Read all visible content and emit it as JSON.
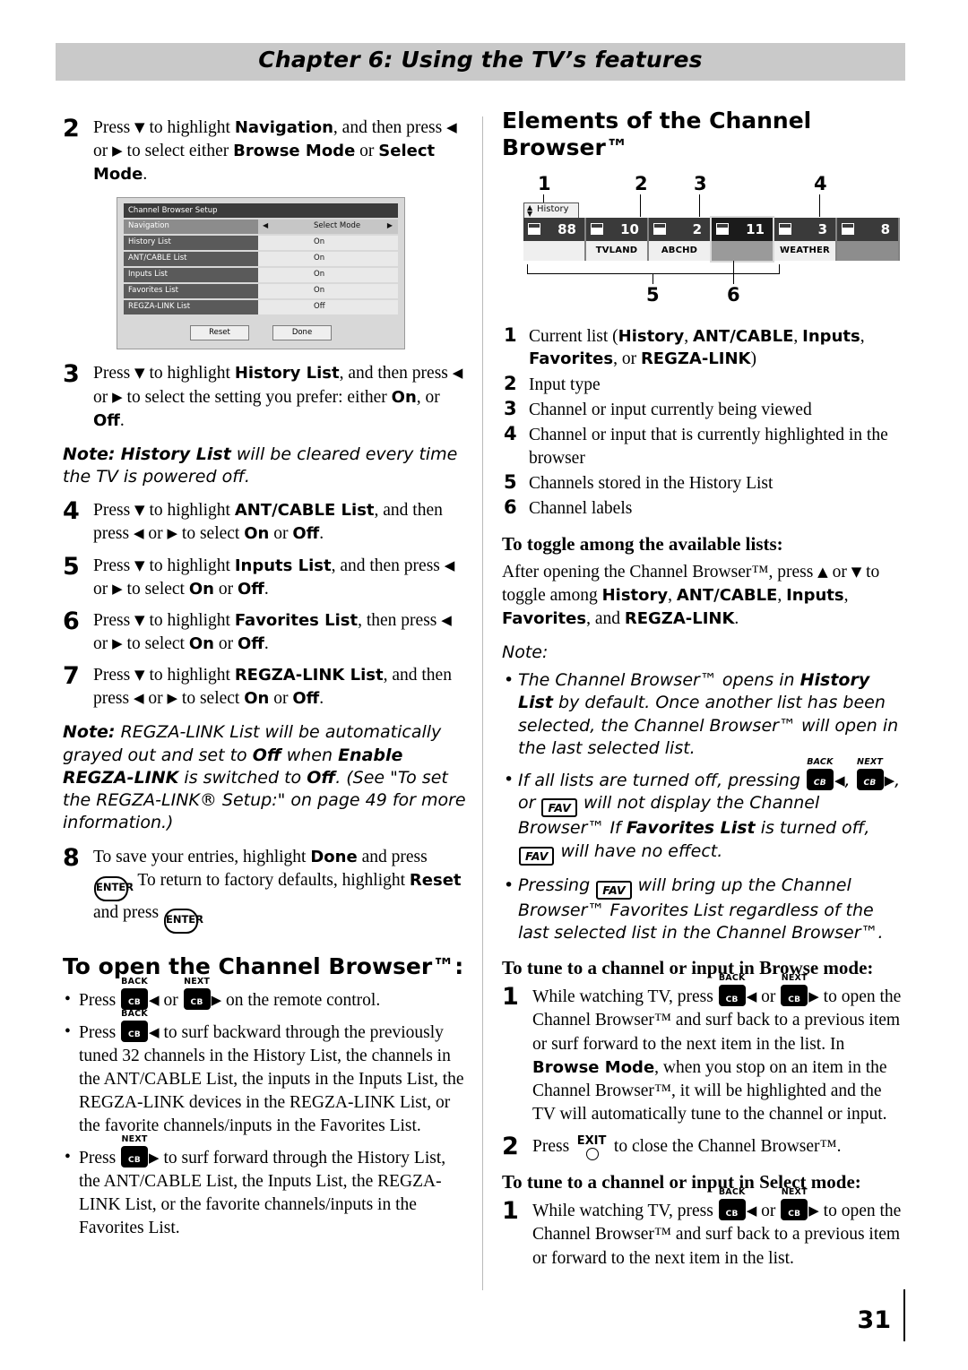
{
  "header": {
    "chapter_title": "Chapter 6: Using the TV’s features"
  },
  "footer": {
    "page_number": "31"
  },
  "left": {
    "step2": {
      "num": "2",
      "text_1": "Press ",
      "arrow_down": "▼",
      "text_2": " to highlight ",
      "b_navigation": "Navigation",
      "text_3": ", and then press ",
      "arrow_left": "◀",
      "text_4": " or ",
      "arrow_right": "▶",
      "text_5": " to select either ",
      "b_browse_mode": "Browse Mode",
      "text_6": " or ",
      "b_select_mode": "Select",
      "b_select_mode2": "Mode",
      "text_7": "."
    },
    "menu": {
      "title": "Channel Browser Setup",
      "rows": [
        {
          "label": "Navigation",
          "value": "Select Mode",
          "highlight": true
        },
        {
          "label": "History List",
          "value": "On",
          "highlight": false
        },
        {
          "label": "ANT/CABLE List",
          "value": "On",
          "highlight": false
        },
        {
          "label": "Inputs List",
          "value": "On",
          "highlight": false
        },
        {
          "label": "Favorites List",
          "value": "On",
          "highlight": false
        },
        {
          "label": "REGZA-LINK List",
          "value": "Off",
          "highlight": false
        }
      ],
      "buttons": {
        "reset": "Reset",
        "done": "Done"
      }
    },
    "step3": {
      "num": "3",
      "p1": "Press ",
      "p2": " to highlight ",
      "b1": "History List",
      "p3": ", and then press ",
      "p4": " or ",
      "p5": " to select the setting you prefer: either ",
      "b2": "On",
      "p6": ", or ",
      "b3": "Off",
      "p7": "."
    },
    "note1": {
      "lead": "Note:",
      "b1": "History List",
      "rest": " will be cleared every time the TV is powered off."
    },
    "step4": {
      "num": "4",
      "p1": "Press ",
      "p2": " to highlight ",
      "b1": "ANT/CABLE List",
      "p3": ", and then press ",
      "p4": " or ",
      "p5": " to select ",
      "b2": "On",
      "p6": " or ",
      "b3": "Off",
      "p7": "."
    },
    "step5": {
      "num": "5",
      "p1": "Press ",
      "p2": " to highlight ",
      "b1": "Inputs List",
      "p3": ", and then press ",
      "p4": " or ",
      "p5": " to select ",
      "b2": "On",
      "p6": " or ",
      "b3": "Off",
      "p7": "."
    },
    "step6": {
      "num": "6",
      "p1": "Press ",
      "p2": " to highlight ",
      "b1": "Favorites List",
      "p3": ", then press ",
      "p4": " or ",
      "p5": " to select ",
      "b2": "On",
      "p6": " or ",
      "b3": "Off",
      "p7": "."
    },
    "step7": {
      "num": "7",
      "p1": "Press ",
      "p2": " to highlight ",
      "b1": "REGZA-LINK List",
      "p3": ", and then press ",
      "p4": " or ",
      "p5": " to select ",
      "b2": "On",
      "p6": " or ",
      "b3": "Off",
      "p7": "."
    },
    "note2": {
      "lead": "Note:",
      "t1": " REGZA-LINK List will be automatically grayed out and set to ",
      "b1": "Off",
      "t2": " when ",
      "b2": "Enable REGZA-LINK",
      "t3": " is switched to ",
      "b3": "Off",
      "t4": ". (See \"To set the REGZA-LINK® Setup:\" on page 49 for more information.)"
    },
    "step8": {
      "num": "8",
      "p1": "To save your entries, highlight ",
      "b1": "Done",
      "p2": " and press ",
      "key1": "ENTER",
      "p3": ". To return to factory defaults, highlight ",
      "b2": "Reset",
      "p4": " and press ",
      "key2": "ENTER",
      "p5": "."
    },
    "heading_open": "To open the Channel Browser™:",
    "bullets": [
      {
        "p1": "Press ",
        "k1_top": "BACK",
        "k1_lbl": "CB",
        "a1": "◀",
        "p2": " or ",
        "k2_top": "NEXT",
        "k2_lbl": "CB",
        "a2": "▶",
        "p3": " on the remote control."
      },
      {
        "p1": "Press ",
        "k1_top": "BACK",
        "k1_lbl": "CB",
        "a1": "◀",
        "p2": " to surf backward through the previously tuned 32 channels in the History List, the channels in the ANT/CABLE List, the inputs in the Inputs List, the REGZA-LINK devices in the REGZA-LINK List, or the favorite channels/inputs in the Favorites List."
      },
      {
        "p1": "Press ",
        "k1_top": "NEXT",
        "k1_lbl": "CB",
        "a1": "▶",
        "p2": " to surf forward through the History List, the ANT/CABLE List, the Inputs List, the REGZA-LINK List, or the favorite channels/inputs in the Favorites List."
      }
    ]
  },
  "right": {
    "heading_elements": "Elements of the Channel Browser™",
    "diagram": {
      "callout_numbers_top": [
        "1",
        "2",
        "3",
        "4"
      ],
      "callout_numbers_bottom": [
        "5",
        "6"
      ],
      "tab_label": "History",
      "cells": [
        {
          "channel": "88",
          "label": "",
          "state": "current"
        },
        {
          "channel": "10",
          "label": "TVLAND",
          "state": "normal"
        },
        {
          "channel": "2",
          "label": "ABCHD",
          "state": "normal"
        },
        {
          "channel": "11",
          "label": "",
          "state": "selected"
        },
        {
          "channel": "3",
          "label": "WEATHER",
          "state": "normal"
        },
        {
          "channel": "8",
          "label": "",
          "state": "empty"
        }
      ]
    },
    "legend": [
      {
        "n": "1",
        "t1": "Current list (",
        "b1": "History",
        "t2": ", ",
        "b2": "ANT/CABLE",
        "t3": ", ",
        "b3": "Inputs",
        "t4": ", ",
        "b4": "Favorites",
        "t5": ", or ",
        "b5": "REGZA-LINK",
        "t6": ")"
      },
      {
        "n": "2",
        "t1": "Input type"
      },
      {
        "n": "3",
        "t1": "Channel or input currently being viewed"
      },
      {
        "n": "4",
        "t1": "Channel or input that is currently highlighted in the browser"
      },
      {
        "n": "5",
        "t1": "Channels stored in the History List"
      },
      {
        "n": "6",
        "t1": "Channel labels"
      }
    ],
    "heading_toggle": "To toggle among the available lists:",
    "toggle_text": {
      "p1": "After opening the Channel Browser™, press ",
      "a_up": "▲",
      "p2": " or ",
      "a_down": "▼",
      "p3": " to toggle among ",
      "b1": "History",
      "p4": ", ",
      "b2": "ANT/CABLE",
      "p5": ", ",
      "b3": "Inputs",
      "p6": ", ",
      "b4": "Favorites",
      "p7": ", and ",
      "b5": "REGZA-LINK",
      "p8": "."
    },
    "note_label": "Note:",
    "notes": [
      {
        "t1": "The Channel Browser™ opens in ",
        "b1": "History List",
        "t2": " by default. Once another list has been selected, the Channel Browser™ will open in the last selected list."
      }
    ],
    "note_keys": {
      "t1": "If all lists are turned off, pressing ",
      "k1_top": "BACK",
      "k1_lbl": "CB",
      "a1": "◀",
      "t2": ", ",
      "k2_top": "NEXT",
      "k2_lbl": "CB",
      "a2": "▶",
      "t3": ", or ",
      "k3": "FAV",
      "t4": " will not display the Channel Browser™ If ",
      "b1": "Favorites List",
      "t5": " is turned off, ",
      "k4": "FAV",
      "t6": " will have no effect."
    },
    "note_fav": {
      "t1": "Pressing ",
      "k1": "FAV",
      "t2": " will bring up the Channel Browser™ Favorites List regardless of the last selected list in the Channel Browser™."
    },
    "heading_browse": "To tune to a channel or input in Browse mode:",
    "browse_step1": {
      "n": "1",
      "t1": "While watching TV, press ",
      "k1_top": "BACK",
      "k1_lbl": "CB",
      "a1": "◀",
      "t2": " or ",
      "k2_top": "NEXT",
      "k2_lbl": "CB",
      "a2": "▶",
      "t3": " to open the Channel Browser™ and surf back to a previous item or surf forward to the next item in the list. In ",
      "b1": "Browse Mode",
      "t4": ", when you stop on an item in the Channel Browser™, it will be highlighted and the TV will automatically tune to the channel or input."
    },
    "browse_step2": {
      "n": "2",
      "t1": "Press ",
      "k1": "EXIT",
      "t2": " to close the Channel Browser™."
    },
    "heading_select": "To tune to a channel or input in Select mode:",
    "select_step1": {
      "n": "1",
      "t1": "While watching TV, press ",
      "k1_top": "BACK",
      "k1_lbl": "CB",
      "a1": "◀",
      "t2": " or ",
      "k2_top": "NEXT",
      "k2_lbl": "CB",
      "a2": "▶",
      "t3": " to open the Channel Browser™ and surf back to a previous item or forward to the next item in the list."
    }
  }
}
